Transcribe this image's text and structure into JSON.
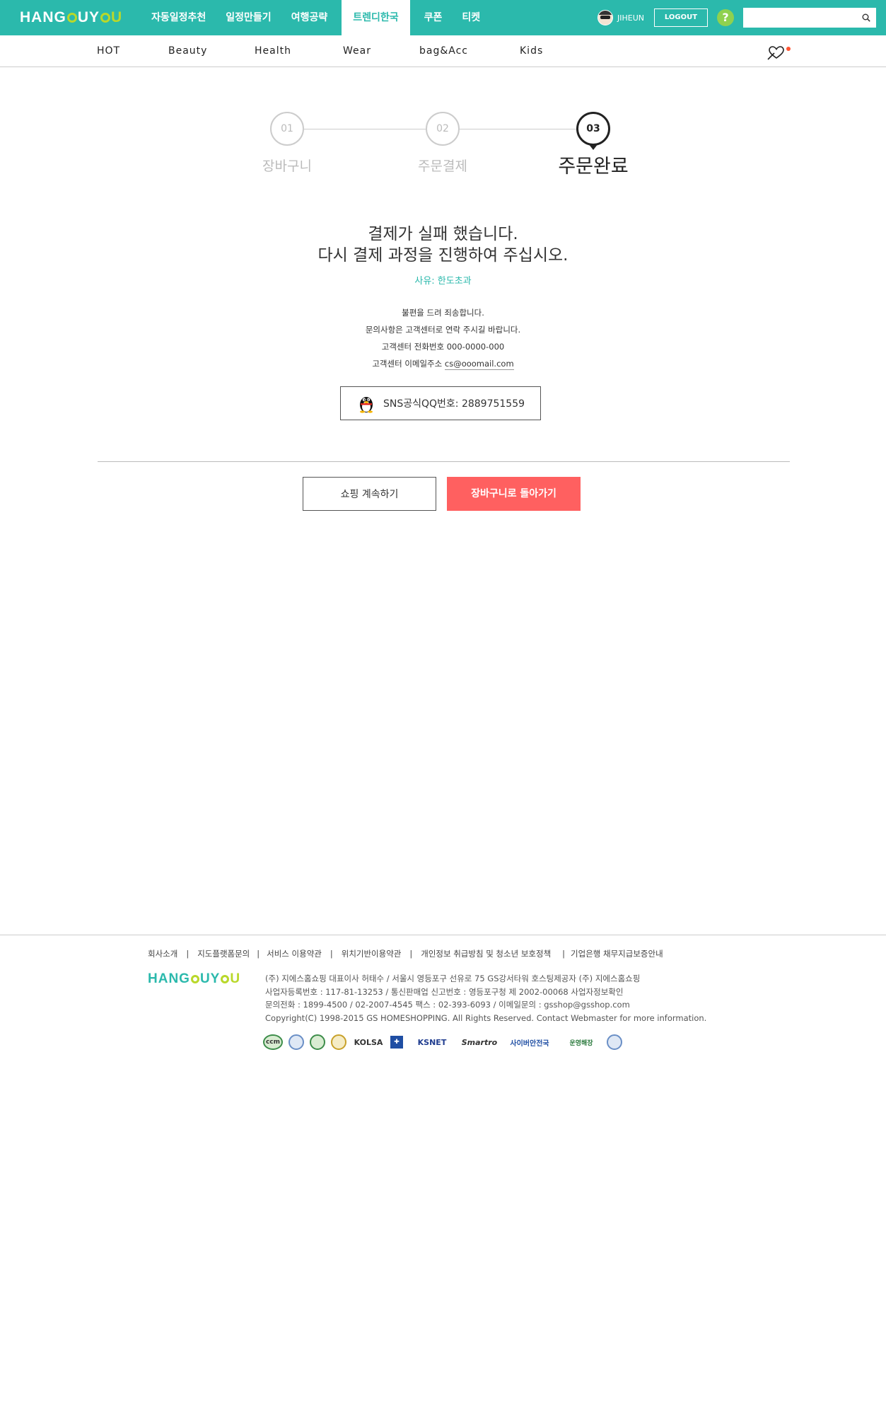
{
  "header": {
    "logo": {
      "part1": "HANG",
      "part2": "UY",
      "part3": "U"
    },
    "nav": [
      "자동일정추천",
      "일정만들기",
      "여행공략",
      "트렌디한국",
      "쿠폰",
      "티켓"
    ],
    "active_nav": "트렌디한국",
    "username": "JIHEUN",
    "logout_label": "LOGOUT",
    "help_label": "?",
    "search_placeholder": ""
  },
  "categories": [
    "HOT",
    "Beauty",
    "Health",
    "Wear",
    "bag&Acc",
    "Kids"
  ],
  "steps": [
    {
      "num": "01",
      "label": "장바구니"
    },
    {
      "num": "02",
      "label": "주문결제"
    },
    {
      "num": "03",
      "label": "주문완료"
    }
  ],
  "message": {
    "line1": "결제가 실패 했습니다.",
    "line2": "다시 결제 과정을 진행하여 주십시오.",
    "reason": "사유: 한도초과",
    "info1": "불편을 드려 죄송합니다.",
    "info2": "문의사항은 고객센터로 연락 주시길 바랍니다.",
    "info3": "고객센터 전화번호 000-0000-000",
    "info4_prefix": "고객센터 이메일주소",
    "info4_email": "cs@ooomail.com"
  },
  "qq": {
    "label": "SNS공식QQ번호: 2889751559"
  },
  "buttons": {
    "continue": "쇼핑 계속하기",
    "back_to_cart": "장바구니로 돌아가기"
  },
  "footer": {
    "links": [
      "회사소개",
      "지도플랫폼문의",
      "서비스 이용약관",
      "위치기반이용약관",
      "개인정보 취급방침 및 청소년 보호정책",
      "기업은행 채무지급보증안내"
    ],
    "logo": {
      "part1": "HANG",
      "part2": "UY",
      "part3": "U"
    },
    "info": [
      "(주) 지에스홈쇼핑 대표이사 허태수 / 서울시 영등포구 선유로 75 GS강서타워 호스팅제공자 (주) 지에스홈쇼핑",
      "사업자등록번호 : 117-81-13253 / 통신판매업 신고번호 : 영등포구청 제 2002-00068 사업자정보확인",
      "문의전화 : 1899-4500 / 02-2007-4545 팩스 : 02-393-6093 / 이메일문의 : gsshop@gsshop.com",
      "Copyright(C) 1998-2015 GS HOMESHOPPING. All Rights Reserved. Contact Webmaster for more information."
    ],
    "badges": [
      "ccm",
      "",
      "",
      "",
      "KOLSA",
      "",
      "KSNET",
      "Smartro",
      "사이버안전국",
      "운영해장",
      ""
    ]
  },
  "colors": {
    "brand": "#2bb9ac",
    "accent": "#b9d82a",
    "cta": "#ff6060"
  }
}
